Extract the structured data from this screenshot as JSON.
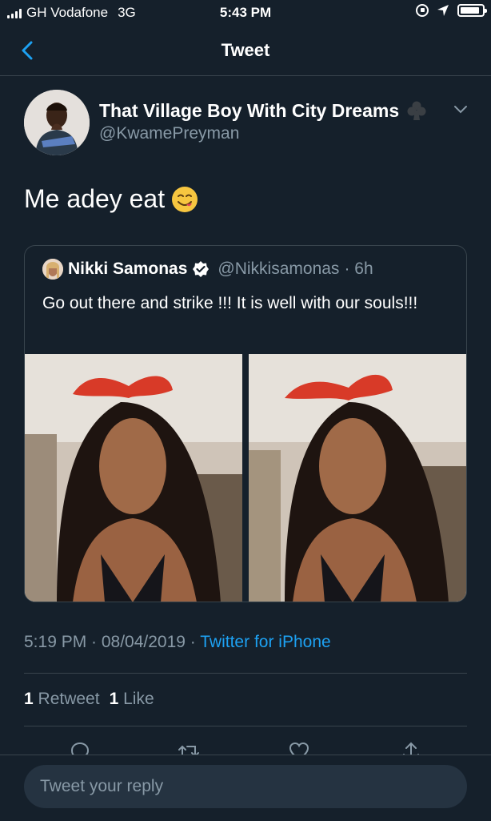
{
  "status_bar": {
    "carrier": "GH Vodafone",
    "network": "3G",
    "time": "5:43 PM",
    "battery_level": 0.9,
    "icons": [
      "signal-icon",
      "rotation-lock-icon",
      "location-icon",
      "battery-icon"
    ]
  },
  "nav": {
    "title": "Tweet",
    "back_icon": "chevron-left-icon"
  },
  "tweet": {
    "user_name": "That Village Boy With City Dreams",
    "name_emoji": "club-suit-icon",
    "handle": "@KwamePreyman",
    "text": "Me adey eat",
    "text_emoji": "yum-face-emoji",
    "timestamp": "5:19 PM · 08/04/2019 · ",
    "source": "Twitter for iPhone",
    "retweets_count": "1",
    "retweets_label": "Retweet",
    "likes_count": "1",
    "likes_label": "Like"
  },
  "quoted": {
    "name": "Nikki Samonas",
    "verified": true,
    "handle": "@Nikkisamonas",
    "time": "· 6h",
    "text": "Go out there and strike !!! It is well with our souls!!!",
    "images": [
      "photo-1",
      "photo-2"
    ]
  },
  "reply": {
    "placeholder": "Tweet your reply"
  },
  "colors": {
    "background": "#15202b",
    "secondary_text": "#8899a6",
    "accent": "#1da1f2",
    "border": "#38444d"
  }
}
